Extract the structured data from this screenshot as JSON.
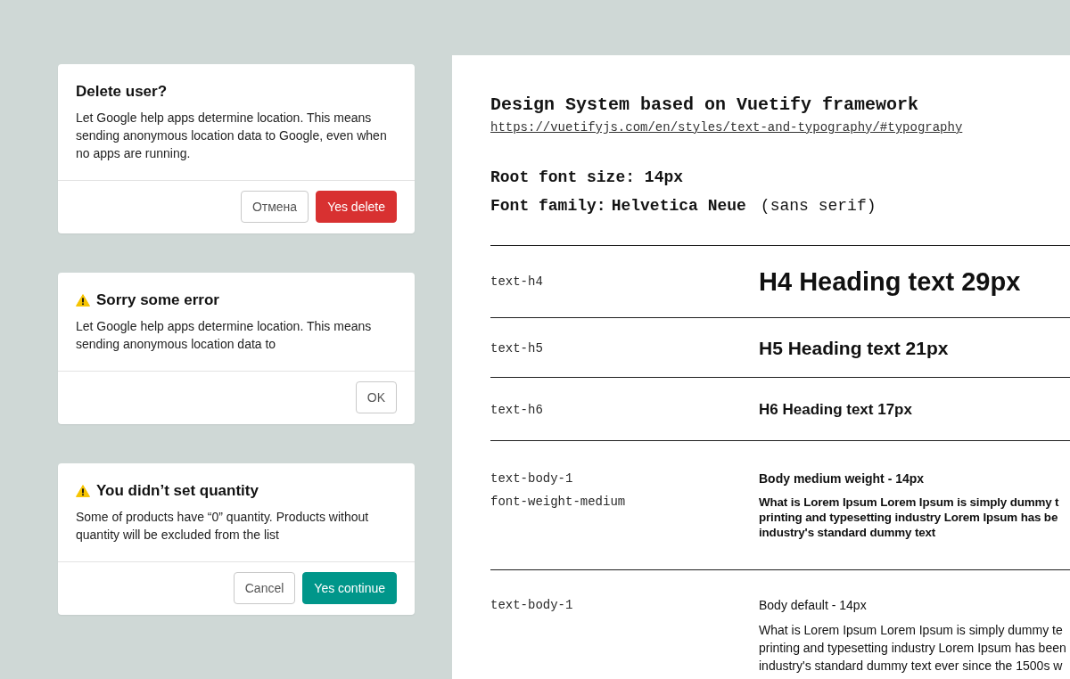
{
  "dialogs": [
    {
      "kind": "plain",
      "title": "Delete user?",
      "message": "Let Google help apps determine location. This means sending anonymous location data to Google, even when no apps are running.",
      "buttons": [
        {
          "label": "Отмена",
          "kind": "secondary"
        },
        {
          "label": "Yes delete",
          "kind": "danger"
        }
      ]
    },
    {
      "kind": "warning",
      "title": "Sorry some error",
      "message": "Let Google help apps determine location. This means sending anonymous location data to",
      "buttons": [
        {
          "label": "OK",
          "kind": "secondary"
        }
      ]
    },
    {
      "kind": "warning",
      "title": "You didn’t set quantity",
      "message": "Some of products have “0” quantity. Products without quantity will be excluded from the list",
      "buttons": [
        {
          "label": "Cancel",
          "kind": "secondary"
        },
        {
          "label": "Yes continue",
          "kind": "primary"
        }
      ]
    }
  ],
  "spec_sheet": {
    "title": "Design System based on Vuetify framework",
    "link": "https://vuetifyjs.com/en/styles/text-and-typography/#typography",
    "root_font_size": "Root font size: 14px",
    "font_family": {
      "label": "Font family:",
      "value": "Helvetica Neue",
      "note": "(sans serif)"
    },
    "rows": [
      {
        "kind": "h4",
        "tokens": [
          "text-h4"
        ],
        "sample": "H4 Heading text 29px"
      },
      {
        "kind": "h5",
        "tokens": [
          "text-h5"
        ],
        "sample": "H5 Heading text 21px"
      },
      {
        "kind": "h6",
        "tokens": [
          "text-h6"
        ],
        "sample": "H6 Heading text 17px"
      },
      {
        "kind": "body-medium",
        "tokens": [
          "text-body-1",
          "font-weight-medium"
        ],
        "caption": "Body medium weight - 14px",
        "paragraph": [
          "What is Lorem Ipsum Lorem Ipsum is simply dummy t",
          "printing and typesetting industry Lorem Ipsum has be",
          "industry's standard dummy text"
        ]
      },
      {
        "kind": "body",
        "tokens": [
          "text-body-1"
        ],
        "caption": "Body default - 14px",
        "paragraph": [
          "What is Lorem Ipsum Lorem Ipsum is simply dummy te",
          "printing and typesetting industry Lorem Ipsum has been",
          "industry's standard dummy text ever since the 1500s w"
        ]
      }
    ]
  }
}
